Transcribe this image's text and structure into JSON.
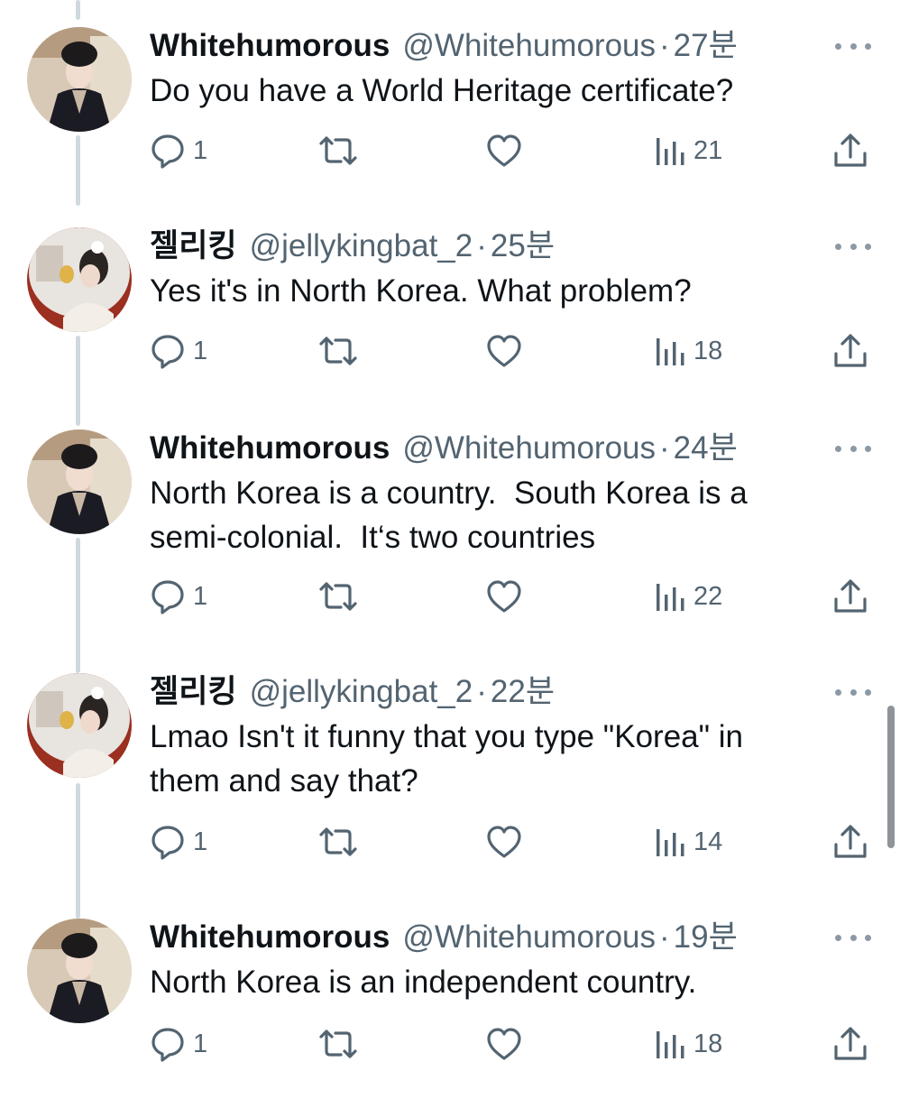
{
  "tweets": [
    {
      "name": "Whitehumorous",
      "handle": "@Whitehumorous",
      "time": "27분",
      "text": "Do you have a World Heritage certificate?",
      "replies": "1",
      "views": "21",
      "avatar": "lady-hanfu"
    },
    {
      "name": "젤리킹",
      "handle": "@jellykingbat_2",
      "time": "25분",
      "text": "Yes it's in North Korea. What problem?",
      "replies": "1",
      "views": "18",
      "avatar": "mirror-selfie"
    },
    {
      "name": "Whitehumorous",
      "handle": "@Whitehumorous",
      "time": "24분",
      "text": "North Korea is a country.  South Korea is a\nsemi-colonial.  It‘s two countries",
      "replies": "1",
      "views": "22",
      "avatar": "lady-hanfu"
    },
    {
      "name": "젤리킹",
      "handle": "@jellykingbat_2",
      "time": "22분",
      "text": "Lmao Isn't it funny that you type \"Korea\" in\nthem and say that?",
      "replies": "1",
      "views": "14",
      "avatar": "mirror-selfie"
    },
    {
      "name": "Whitehumorous",
      "handle": "@Whitehumorous",
      "time": "19분",
      "text": "North Korea is an independent country.",
      "replies": "1",
      "views": "18",
      "avatar": "lady-hanfu"
    }
  ],
  "separator": "·",
  "icons": {
    "reply": "reply-bubble-icon",
    "retweet": "retweet-icon",
    "like": "heart-icon",
    "views": "analytics-bars-icon",
    "share": "share-upload-icon",
    "more": "more-dots-icon"
  },
  "colors": {
    "text": "#0f1419",
    "secondary": "#536471",
    "thread_line": "#cfd9de"
  }
}
